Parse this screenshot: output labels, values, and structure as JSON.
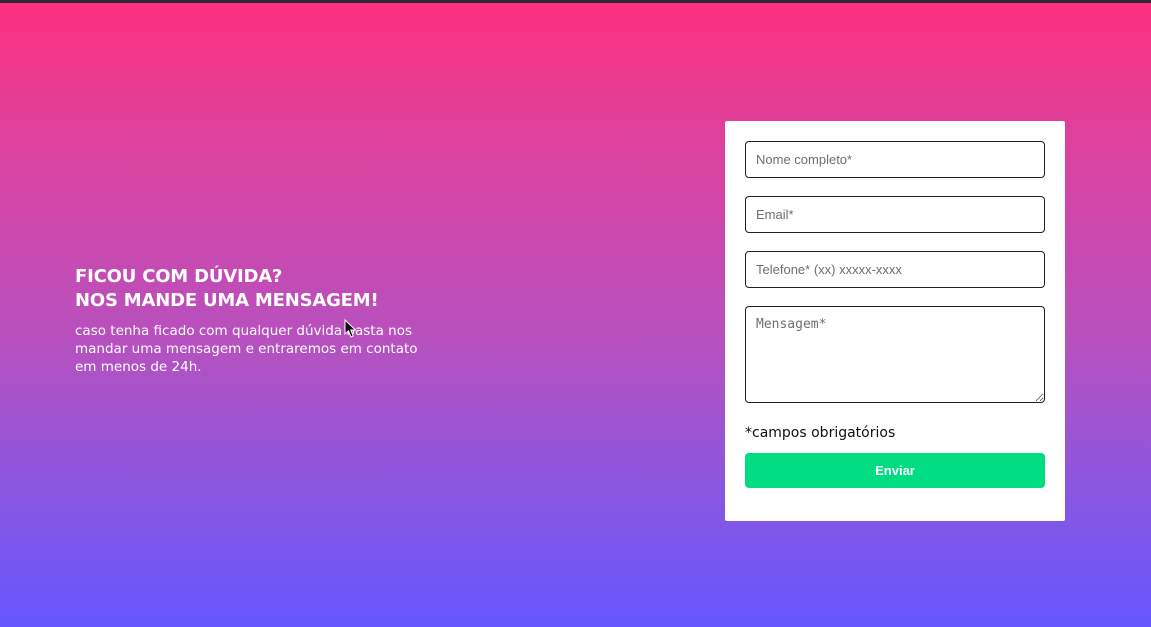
{
  "contact": {
    "headline_line1": "FICOU COM DÚVIDA?",
    "headline_line2": "NOS MANDE UMA MENSAGEM!",
    "subtext": "caso tenha ficado com qualquer dúvida basta nos mandar uma mensagem e entraremos em contato em menos de 24h."
  },
  "form": {
    "name_placeholder": "Nome completo*",
    "email_placeholder": "Email*",
    "phone_placeholder": "Telefone* (xx) xxxxx-xxxx",
    "message_placeholder": "Mensagem*",
    "required_note": "*campos obrigatórios",
    "submit_label": "Enviar"
  },
  "colors": {
    "gradient_top": "#ff2f7e",
    "gradient_bottom": "#6656ff",
    "submit_button": "#00dc82"
  },
  "icons": {
    "cursor": "mouse-pointer-icon"
  }
}
